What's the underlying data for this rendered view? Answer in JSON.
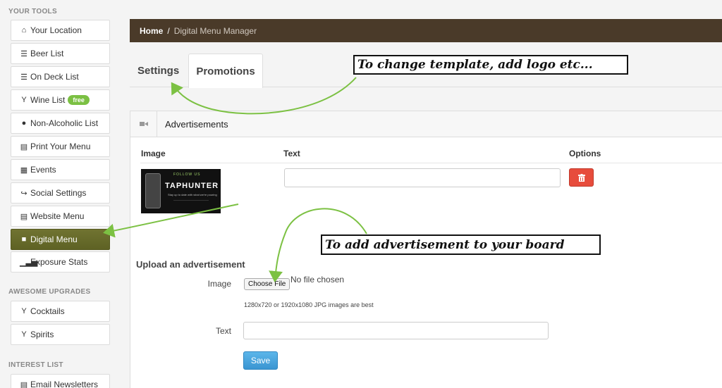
{
  "sidebar": {
    "section_tools": "YOUR TOOLS",
    "section_upgrades": "AWESOME UPGRADES",
    "section_interest": "INTEREST LIST",
    "items": [
      {
        "label": "Your Location",
        "icon": "home-icon"
      },
      {
        "label": "Beer List",
        "icon": "list-icon"
      },
      {
        "label": "On Deck List",
        "icon": "list-icon"
      },
      {
        "label": "Wine List",
        "icon": "glass-icon",
        "badge": "free"
      },
      {
        "label": "Non-Alcoholic List",
        "icon": "drop-icon"
      },
      {
        "label": "Print Your Menu",
        "icon": "print-icon"
      },
      {
        "label": "Events",
        "icon": "calendar-icon"
      },
      {
        "label": "Social Settings",
        "icon": "share-icon"
      },
      {
        "label": "Website Menu",
        "icon": "list-alt-icon"
      },
      {
        "label": "Digital Menu",
        "icon": "video-icon",
        "active": true
      },
      {
        "label": "Exposure Stats",
        "icon": "signal-icon"
      }
    ],
    "upgrades": [
      {
        "label": "Cocktails",
        "icon": "glass-icon"
      },
      {
        "label": "Spirits",
        "icon": "glass-icon"
      }
    ],
    "interest": [
      {
        "label": "Email Newsletters",
        "icon": "list-alt-icon"
      }
    ]
  },
  "breadcrumb": {
    "home": "Home",
    "separator": "/",
    "current": "Digital Menu Manager"
  },
  "tabs": {
    "settings": "Settings",
    "promotions": "Promotions"
  },
  "panel": {
    "title": "Advertisements",
    "columns": {
      "image": "Image",
      "text": "Text",
      "options": "Options"
    },
    "ad": {
      "follow_us": "FOLLOW US",
      "brand": "TAPHUNTER",
      "tagline": "Stay up to date with what we're pouring",
      "text_value": ""
    }
  },
  "upload": {
    "title": "Upload an advertisement",
    "image_label": "Image",
    "choose_button": "Choose File",
    "no_file": "No file chosen",
    "hint": "1280x720 or 1920x1080 JPG images are best",
    "text_label": "Text",
    "text_value": "",
    "save_button": "Save"
  },
  "annotations": {
    "template_note": "To change template, add logo etc...",
    "advert_note": "To add advertisement to your board"
  },
  "colors": {
    "breadcrumb_bg": "#4a3a29",
    "active_nav": "#6b6f28",
    "delete_button": "#e74c3c",
    "save_button": "#4aa3df",
    "annotation_arrow": "#7cc143",
    "free_badge": "#7bc043"
  }
}
